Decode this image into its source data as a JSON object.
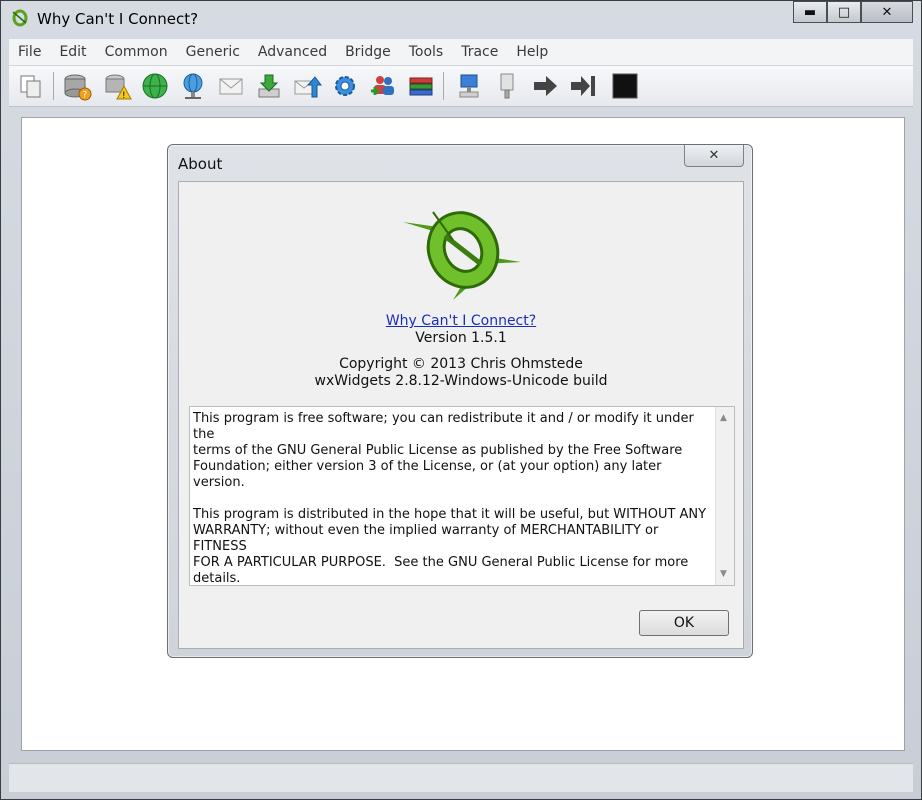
{
  "window": {
    "title": "Why Can't I Connect?"
  },
  "caption": {
    "minimize": "▬",
    "maximize": "□",
    "close": "✕"
  },
  "menu": [
    "File",
    "Edit",
    "Common",
    "Generic",
    "Advanced",
    "Bridge",
    "Tools",
    "Trace",
    "Help"
  ],
  "toolbar": {
    "icons": [
      "copy-icon",
      "database-help-icon",
      "database-warning-icon",
      "globe-icon",
      "globe-connect-icon",
      "mail-icon",
      "download-icon",
      "mail-send-icon",
      "gear-network-icon",
      "users-add-icon",
      "books-icon",
      "computer-icon",
      "network-plug-icon",
      "arrow-right-icon",
      "step-forward-icon",
      "stop-icon"
    ]
  },
  "about": {
    "title": "About",
    "close_glyph": "✕",
    "app_link": "Why Can't I Connect?",
    "version": "Version 1.5.1",
    "copyright": "Copyright © 2013 Chris Ohmstede",
    "build": "wxWidgets 2.8.12-Windows-Unicode build",
    "license_text": "This program is free software; you can redistribute it and / or modify it under the\nterms of the GNU General Public License as published by the Free Software\nFoundation; either version 3 of the License, or (at your option) any later version.\n\nThis program is distributed in the hope that it will be useful, but WITHOUT ANY\nWARRANTY; without even the implied warranty of MERCHANTABILITY or FITNESS\nFOR A PARTICULAR PURPOSE.  See the GNU General Public License for more details.",
    "scroll_up": "▲",
    "scroll_down": "▼",
    "ok_label": "OK"
  },
  "colors": {
    "accent_green": "#5fae2a",
    "link": "#1a2fb8"
  }
}
